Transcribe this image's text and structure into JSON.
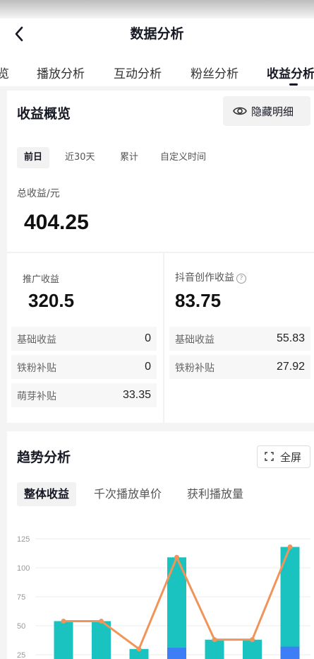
{
  "header": {
    "title": "数据分析"
  },
  "tabs": [
    {
      "label": "览"
    },
    {
      "label": "播放分析"
    },
    {
      "label": "互动分析"
    },
    {
      "label": "粉丝分析"
    },
    {
      "label": "收益分析",
      "active": true
    }
  ],
  "overview": {
    "title": "收益概览",
    "hide_label": "隐藏明细",
    "range_tabs": [
      "前日",
      "近30天",
      "累计",
      "自定义时间"
    ],
    "active_range": "前日",
    "total_label": "总收益/元",
    "total_value": "404.25",
    "promo": {
      "label": "推广收益",
      "value": "320.5",
      "rows": [
        {
          "k": "基础收益",
          "v": "0"
        },
        {
          "k": "铁粉补贴",
          "v": "0"
        },
        {
          "k": "萌芽补贴",
          "v": "33.35"
        }
      ]
    },
    "creation": {
      "label": "抖音创作收益",
      "info_icon": "?",
      "value": "83.75",
      "rows": [
        {
          "k": "基础收益",
          "v": "55.83"
        },
        {
          "k": "铁粉补贴",
          "v": "27.92"
        }
      ]
    }
  },
  "trend": {
    "title": "趋势分析",
    "fullscreen_label": "全屏",
    "metric_tabs": [
      "整体收益",
      "千次播放单价",
      "获利播放量"
    ],
    "active_metric": "整体收益"
  },
  "colors": {
    "bar": "#1bc3c0",
    "bar_bottom": "#3d7df5",
    "line": "#f0945a",
    "text": "#161823"
  },
  "chart_data": {
    "type": "bar",
    "y_ticks": [
      "125",
      "100",
      "75",
      "50",
      "25"
    ],
    "ylim": [
      0,
      125
    ],
    "series": [
      {
        "type": "bar",
        "values": [
          54,
          54,
          30,
          109,
          38,
          38,
          118
        ]
      },
      {
        "type": "bar",
        "values": [
          0,
          0,
          0,
          31,
          0,
          0,
          32
        ]
      },
      {
        "type": "line",
        "values": [
          54,
          54,
          30,
          109,
          38,
          38,
          118
        ]
      }
    ]
  }
}
